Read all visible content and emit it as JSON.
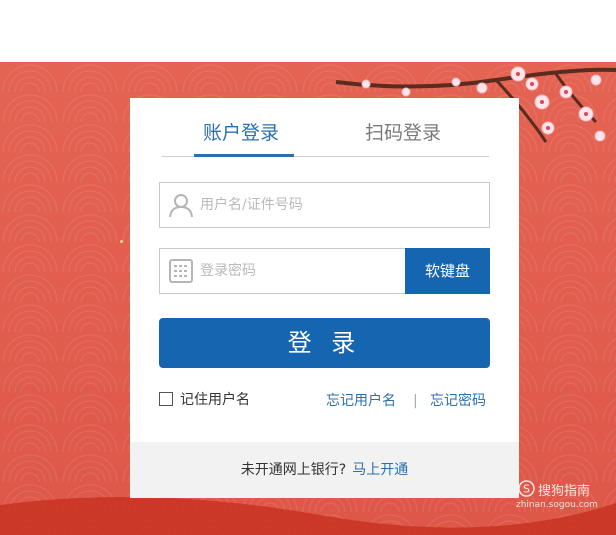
{
  "tabs": {
    "account_login": "账户登录",
    "qr_login": "扫码登录"
  },
  "form": {
    "username_placeholder": "用户名/证件号码",
    "username_value": "",
    "password_placeholder": "登录密码",
    "password_value": "",
    "soft_keyboard_label": "软键盘",
    "login_button_label": "登 录"
  },
  "options": {
    "remember_username": "记住用户名",
    "remember_checked": false,
    "forgot_username": "忘记用户名",
    "separator": "|",
    "forgot_password": "忘记密码"
  },
  "footer": {
    "prompt": "未开通网上银行?",
    "open_now": "马上开通"
  },
  "watermark": {
    "brand": "搜狗指南",
    "url": "zhinan.sogou.com",
    "icon": "sogou-logo-icon"
  },
  "colors": {
    "accent": "#1565b1",
    "link": "#2b6fb0",
    "banner": "#e05c4c"
  }
}
